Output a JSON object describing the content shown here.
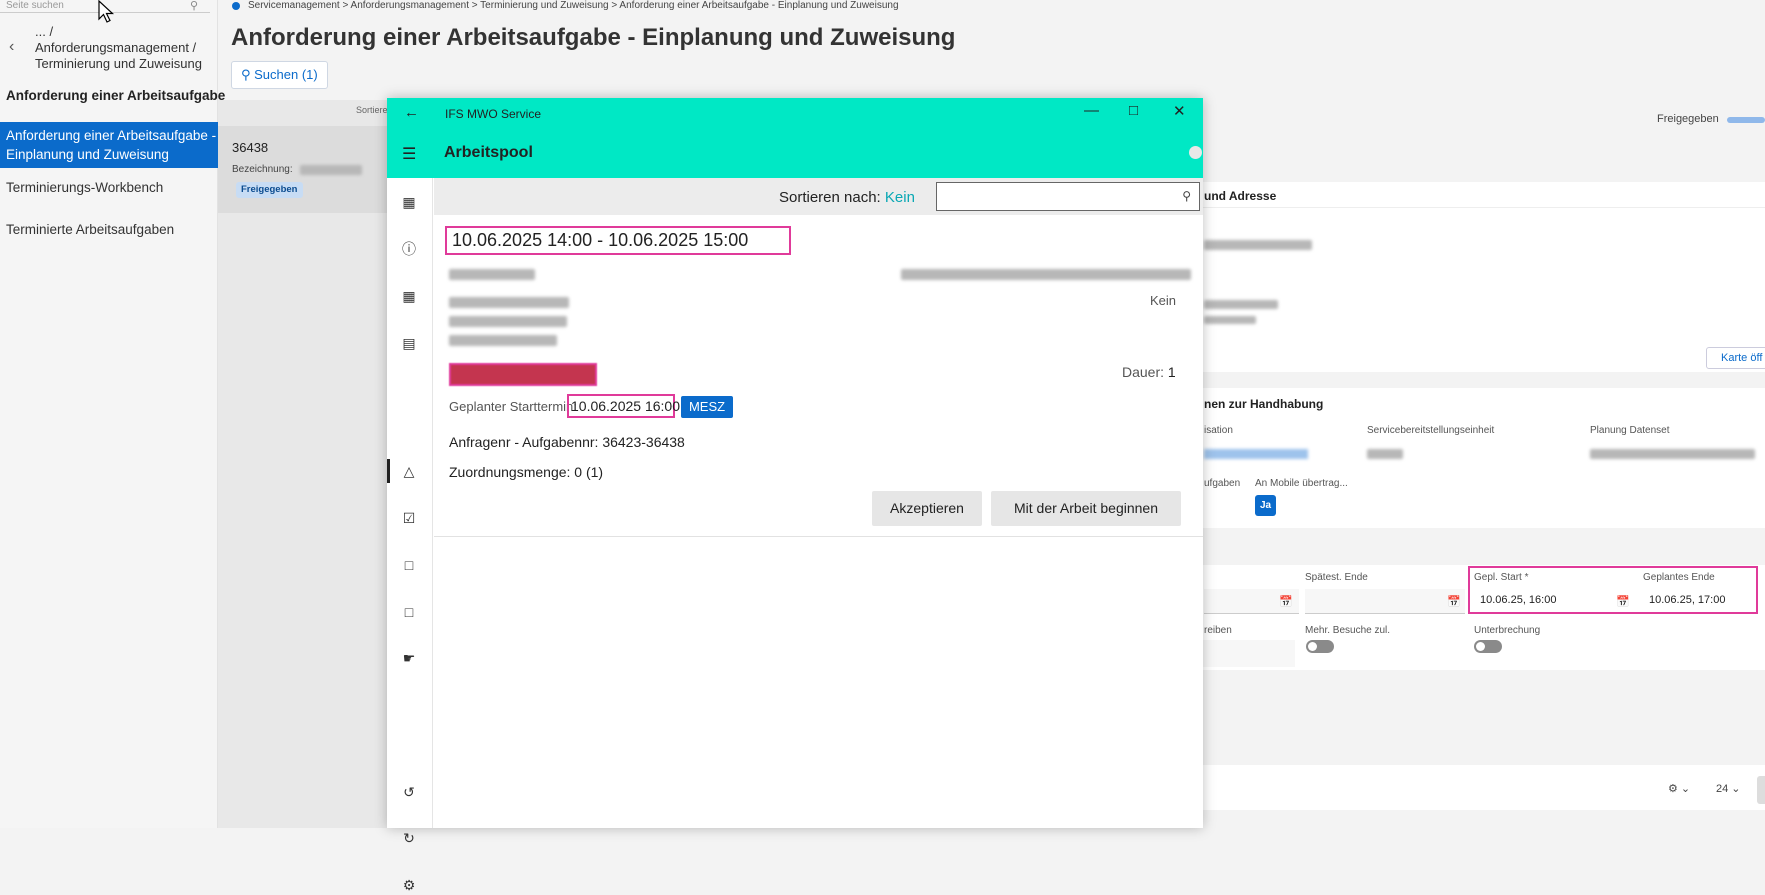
{
  "leftnav": {
    "search_placeholder": "Seite suchen",
    "crumb_line1": "... /",
    "crumb_line2": "Anforderungsmanagement /",
    "crumb_line3": "Terminierung und Zuweisung",
    "heading": "Anforderung einer Arbeitsaufgabe",
    "items": [
      "Anforderung einer Arbeitsaufgabe - Einplanung und Zuweisung",
      "Terminierungs-Workbench",
      "Terminierte Arbeitsaufgaben"
    ],
    "active_line1": "Anforderung einer Arbeitsaufgabe -",
    "active_line2": "Einplanung und Zuweisung"
  },
  "breadcrumbs": [
    "Servicemanagement",
    "Anforderungsmanagement",
    "Terminierung und Zuweisung",
    "Anforderung einer Arbeitsaufgabe - Einplanung und Zuweisung"
  ],
  "breadcrumb_text": "Servicemanagement  >  Anforderungsmanagement  >  Terminierung und Zuweisung  >  Anforderung einer Arbeitsaufgabe - Einplanung und Zuweisung",
  "page": {
    "title": "Anforderung einer Arbeitsaufgabe - Einplanung und Zuweisung",
    "search_button": "Suchen (1)"
  },
  "list": {
    "sort_label": "Sortiere",
    "card_id": "36438",
    "card_label": "Bezeichnung:",
    "card_status": "Freigegeben"
  },
  "right": {
    "status_label": "Freigegeben",
    "status_progress": 0.4,
    "section1_title": "und Adresse",
    "karte_button": "Karte öff",
    "section2_title": "nen zur Handhabung",
    "lbl_isation": "isation",
    "lbl_servicebereit": "Servicebereitstellungseinheit",
    "lbl_planung": "Planung Datenset",
    "lbl_ufgaben": "ufgaben",
    "lbl_mobile": "An Mobile übertrag...",
    "ja": "Ja",
    "lbl_spaetest_ende": "Spätest. Ende",
    "lbl_gepl_start": "Gepl. Start *",
    "lbl_geplantes_ende": "Geplantes Ende",
    "val_gepl_start": "10.06.25, 16:00",
    "val_geplantes_ende": "10.06.25, 17:00",
    "lbl_reiben": "reiben",
    "lbl_mehr_besuche": "Mehr. Besuche zul.",
    "lbl_unterbrechung": "Unterbrechung",
    "page_size": "24"
  },
  "modal": {
    "app_title": "IFS MWO Service",
    "page_title": "Arbeitspool",
    "sort_label": "Sortieren nach:",
    "sort_value": "Kein",
    "date_range": "10.06.2025 14:00 - 10.06.2025 15:00",
    "kein": "Kein",
    "dauer_label": "Dauer:",
    "dauer_value": "1",
    "geplant_label": "Geplanter Starttermin:",
    "geplant_value": "10.06.2025 16:00",
    "timezone": "MESZ",
    "anfragenr": "Anfragenr - Aufgabennr: 36423-36438",
    "zuordnung": "Zuordnungsmenge: 0 (1)",
    "accept_button": "Akzeptieren",
    "start_button": "Mit der Arbeit beginnen"
  }
}
